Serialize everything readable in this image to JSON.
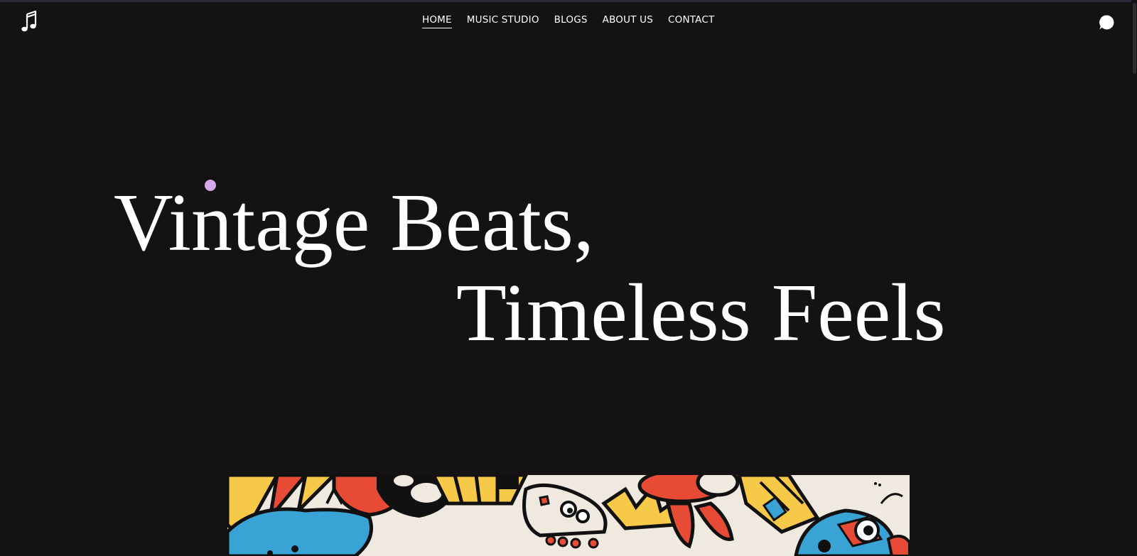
{
  "header": {
    "logo_icon": "music-note-icon",
    "chat_icon": "chat-bubble-icon",
    "nav": [
      {
        "label": "HOME",
        "active": true
      },
      {
        "label": "MUSIC STUDIO",
        "active": false
      },
      {
        "label": "BLOGS",
        "active": false
      },
      {
        "label": "ABOUT US",
        "active": false
      },
      {
        "label": "CONTACT",
        "active": false
      }
    ]
  },
  "hero": {
    "line1": "Vintage Beats,",
    "line2": "Timeless Feels"
  },
  "colors": {
    "background": "#141213",
    "text": "#ffffff",
    "cursor_dot": "#d7a7ee",
    "art_red": "#e84b35",
    "art_blue": "#3aa3d6",
    "art_yellow": "#f7c948",
    "art_cream": "#efe9e0"
  }
}
